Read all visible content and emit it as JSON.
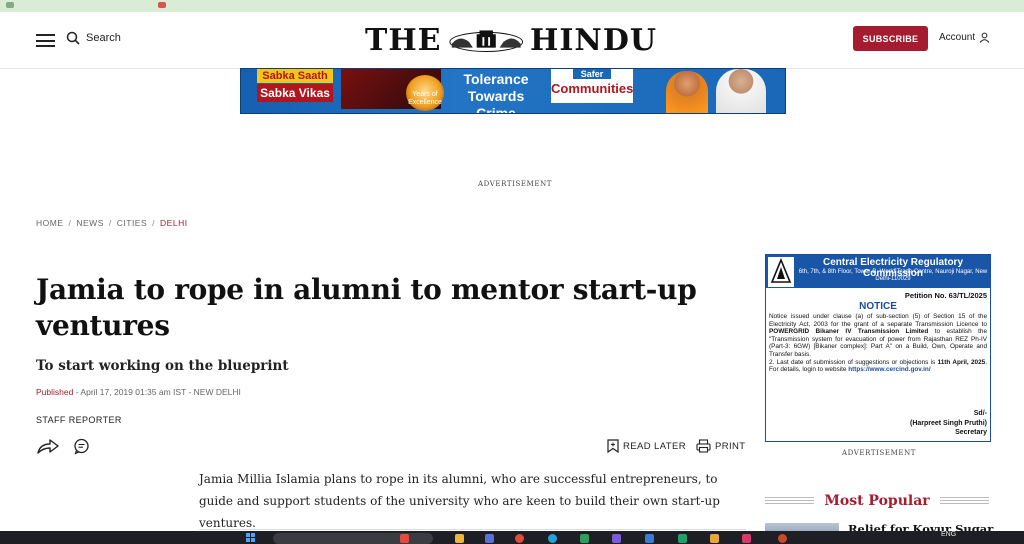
{
  "header": {
    "search_label": "Search",
    "logo_left": "THE",
    "logo_right": "HINDU",
    "subscribe_label": "SUBSCRIBE",
    "account_label": "Account"
  },
  "ad_banner": {
    "line1": "Sabka Saath",
    "line2": "Sabka Vikas",
    "years_text": "Years of Excellence",
    "tolerance": "Tolerance Towards Crime",
    "safer": "Safer",
    "communities": "Communities"
  },
  "advertisement_label": "ADVERTISEMENT",
  "breadcrumb": {
    "items": [
      "HOME",
      "NEWS",
      "CITIES"
    ],
    "current": "DELHI",
    "separator": "/"
  },
  "article": {
    "title": "Jamia to rope in alumni to mentor start-up ventures",
    "subtitle": "To start working on the blueprint",
    "published_label": "Published",
    "dateline": " - April 17, 2019 01:35 am IST - NEW DELHI",
    "byline": "STAFF REPORTER",
    "read_later_label": "READ LATER",
    "print_label": "PRINT",
    "body": "Jamia Millia Islamia plans to rope in its alumni, who are successful entrepreneurs, to guide and support students of the university who are keen to build their own start-up ventures."
  },
  "side_ad": {
    "org": "Central Electricity Regulatory Commission",
    "address": "6th, 7th, & 8th Floor, Tower-B, World Trade Centre, Nauroji Nagar, New Delhi-110029",
    "petition": "Petition No. 63/TL/2025",
    "notice_title": "NOTICE",
    "item1_pre": "Notice issued under clause (a) of sub-section (5) of Section 15 of the Electricity Act, 2003 for the grant of a separate Transmission Licence to ",
    "item1_bold": "POWERGRID Bikaner IV Transmission Limited",
    "item1_post": " to establish the \"Transmission system for evacuation of power from Rajasthan REZ Ph-IV (Part-3: 6GW) [Bikaner complex]: Part A\" on a Build, Own, Operate and Transfer basis.",
    "item2_pre": "2. Last date of submission of suggestions or objections is ",
    "item2_bold": "11th April, 2025",
    "item2_post": ". For details, login to website ",
    "item2_link": "https://www.cercind.gov.in/",
    "sig1": "Sd/-",
    "sig2": "(Harpreet Singh Pruthi)",
    "sig3": "Secretary"
  },
  "most_popular": {
    "heading": "Most Popular",
    "first_item": "Relief for Kovur Sugar"
  },
  "taskbar": {
    "lang": "ENG"
  },
  "colors": {
    "brand_red": "#a51c30",
    "ad_blue": "#1a56a8"
  }
}
